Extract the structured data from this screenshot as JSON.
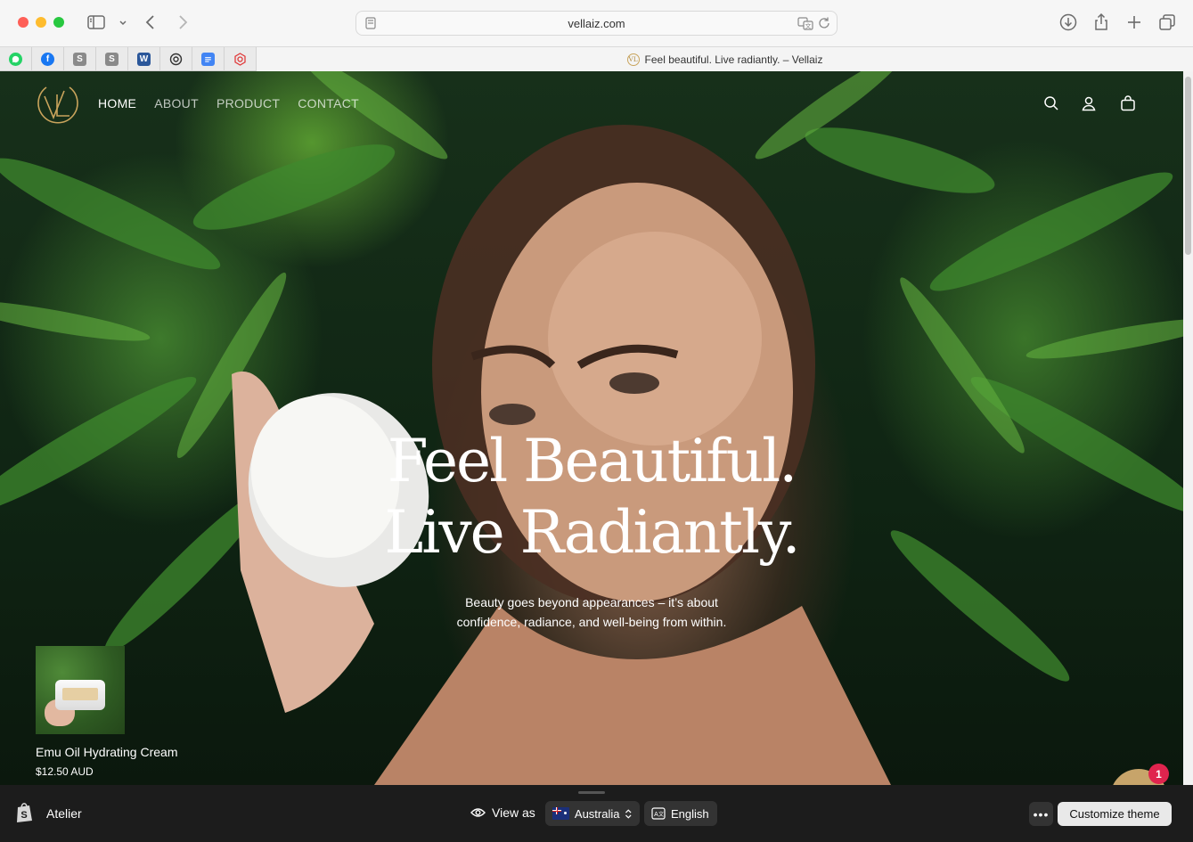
{
  "browser": {
    "url": "vellaiz.com",
    "active_tab_title": "Feel beautiful. Live radiantly. – Vellaiz",
    "pinned_tabs": [
      {
        "name": "whatsapp-icon",
        "glyph": "",
        "color": "#25d366"
      },
      {
        "name": "facebook-icon",
        "glyph": "f",
        "color": "#1877f2"
      },
      {
        "name": "s-app-icon",
        "glyph": "S",
        "color": "#8a8a8a"
      },
      {
        "name": "s-app-icon-2",
        "glyph": "S",
        "color": "#8a8a8a"
      },
      {
        "name": "word-icon",
        "glyph": "W",
        "color": "#2b579a"
      },
      {
        "name": "openai-icon",
        "glyph": "",
        "color": "#333333"
      },
      {
        "name": "docs-icon",
        "glyph": "",
        "color": "#4285f4"
      },
      {
        "name": "extension-icon",
        "glyph": "",
        "color": "#e03a3a"
      }
    ]
  },
  "site": {
    "logo_text": "VL",
    "nav": [
      "HOME",
      "ABOUT",
      "PRODUCT",
      "CONTACT"
    ],
    "active_nav": "HOME",
    "header_icons": [
      "search-icon",
      "account-icon",
      "cart-icon"
    ]
  },
  "hero": {
    "headline_line1": "Feel Beautiful.",
    "headline_line2": "Live Radiantly.",
    "sub_line1": "Beauty goes beyond appearances – it’s about",
    "sub_line2": "confidence, radiance, and well-being from within."
  },
  "featured_product": {
    "name": "Emu Oil Hydrating Cream",
    "price": "$12.50 AUD"
  },
  "chat": {
    "badge_count": "1"
  },
  "preview_bar": {
    "theme_name": "Atelier",
    "view_as_label": "View as",
    "country": "Australia",
    "language": "English",
    "more_label": "•••",
    "customize_label": "Customize theme"
  },
  "colors": {
    "brand_gold": "#c9a45c",
    "preview_bar_bg": "#1c1c1c",
    "badge_red": "#e0244e"
  }
}
